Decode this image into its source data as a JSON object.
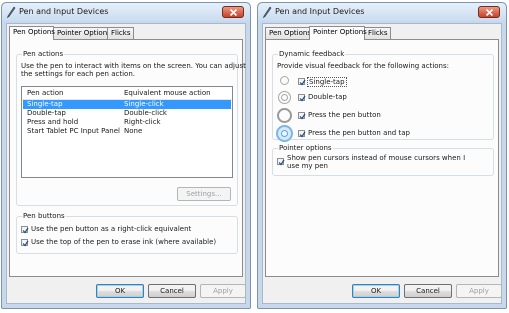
{
  "left": {
    "title": "Pen and Input Devices",
    "tabs": [
      "Pen Options",
      "Pointer Options",
      "Flicks"
    ],
    "pen_actions": {
      "group_label": "Pen actions",
      "description_line1": "Use the pen to interact with items on the screen.  You can adjust",
      "description_line2": "the settings for each pen action.",
      "columns": [
        "Pen action",
        "Equivalent mouse action"
      ],
      "rows": [
        {
          "action": "Single-tap",
          "mouse": "Single-click",
          "selected": true
        },
        {
          "action": "Double-tap",
          "mouse": "Double-click",
          "selected": false
        },
        {
          "action": "Press and hold",
          "mouse": "Right-click",
          "selected": false
        },
        {
          "action": "Start Tablet PC Input Panel",
          "mouse": "None",
          "selected": false
        }
      ],
      "settings_button": "Settings..."
    },
    "pen_buttons": {
      "group_label": "Pen buttons",
      "options": [
        {
          "label": "Use the pen button as a right-click equivalent",
          "checked": true
        },
        {
          "label": "Use the top of the pen to erase ink (where available)",
          "checked": true
        }
      ]
    },
    "buttons": {
      "ok": "OK",
      "cancel": "Cancel",
      "apply": "Apply"
    }
  },
  "right": {
    "title": "Pen and Input Devices",
    "tabs": [
      "Pen Options",
      "Pointer Options",
      "Flicks"
    ],
    "dynamic_feedback": {
      "group_label": "Dynamic feedback",
      "description": "Provide visual feedback for the following actions:",
      "options": [
        {
          "label": "Single-tap",
          "checked": true
        },
        {
          "label": "Double-tap",
          "checked": true
        },
        {
          "label": "Press the pen button",
          "checked": true
        },
        {
          "label": "Press the pen button and tap",
          "checked": true
        }
      ]
    },
    "pointer_options": {
      "group_label": "Pointer options",
      "line1": "Show pen cursors instead of mouse cursors when I",
      "line2": "use my pen",
      "checked": true
    },
    "buttons": {
      "ok": "OK",
      "cancel": "Cancel",
      "apply": "Apply"
    }
  },
  "colors": {
    "selection": "#3399ff",
    "close_button": "#c5432a",
    "window_frame": "#c7d8ec"
  }
}
